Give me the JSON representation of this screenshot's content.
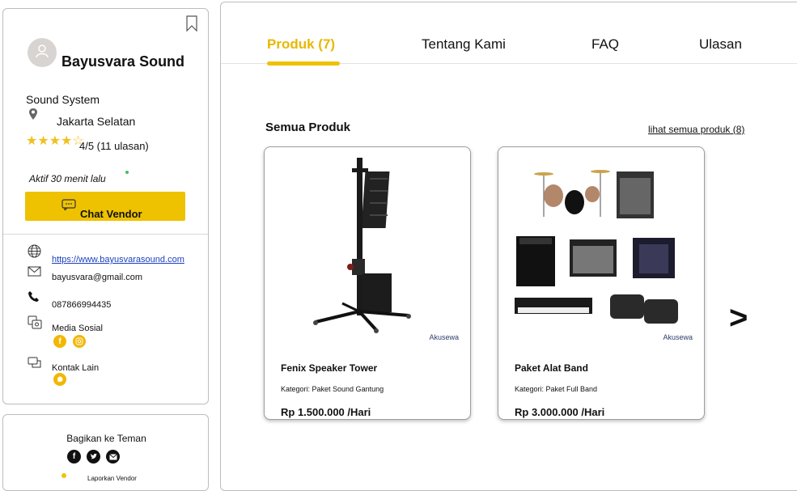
{
  "vendor": {
    "name": "Bayusvara Sound",
    "category": "Sound System",
    "location": "Jakarta Selatan",
    "stars": "★★★★",
    "stars_empty": "☆",
    "rating": "4/5 (11 ulasan)",
    "active_status": "Aktif 30 menit lalu",
    "chat_button": "Chat Vendor"
  },
  "contact": {
    "website": "https://www.bayusvarasound.com",
    "email": "bayusvara@gmail.com",
    "phone": "087866994435",
    "social_label": "Media Sosial",
    "other_contact_label": "Kontak Lain"
  },
  "share": {
    "title": "Bagikan ke Teman",
    "report": "Laporkan Vendor"
  },
  "tabs": [
    {
      "label": "Produk (7)",
      "active": true
    },
    {
      "label": "Tentang Kami",
      "active": false
    },
    {
      "label": "FAQ",
      "active": false
    },
    {
      "label": "Ulasan",
      "active": false
    }
  ],
  "products_section": {
    "title": "Semua Produk",
    "see_all": "lihat semua produk (8)",
    "next": ">"
  },
  "products": [
    {
      "name": "Fenix Speaker Tower",
      "category": "Kategori: Paket Sound Gantung",
      "price": "Rp  1.500.000 /Hari",
      "watermark": "Akusewa"
    },
    {
      "name": "Paket Alat Band",
      "category": "Kategori: Paket Full Band",
      "price": "Rp  3.000.000 /Hari",
      "watermark": "Akusewa"
    }
  ],
  "colors": {
    "accent": "#eec200",
    "active_tab": "#e8b800",
    "link": "#1a3fbf"
  },
  "icons": [
    "bookmark-icon",
    "user-icon",
    "location-pin-icon",
    "globe-icon",
    "mail-icon",
    "phone-icon",
    "social-media-icon",
    "facebook-icon",
    "instagram-icon",
    "chat-bubbles-icon",
    "whatsapp-icon",
    "twitter-icon",
    "chat-icon",
    "info-icon"
  ]
}
